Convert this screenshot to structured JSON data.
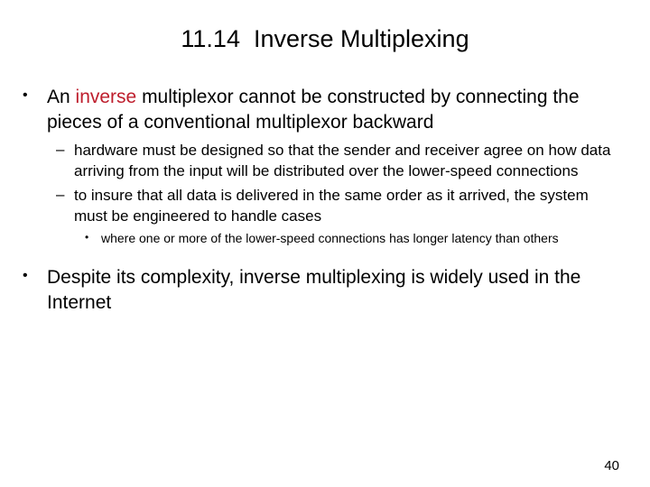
{
  "slide": {
    "title": "11.14  Inverse Multiplexing",
    "page_number": "40",
    "background_color": "#FFFFFF",
    "text_color": "#000000",
    "highlight_color": "#BE1E2D",
    "bullet_glyphs": {
      "level1": "•",
      "level2": "–",
      "level3": "•"
    },
    "bullets": [
      {
        "level": 1,
        "text_before_highlight": "An ",
        "highlight": "inverse",
        "text_after_highlight": " multiplexor cannot be constructed by connecting the pieces of a conventional multiplexor backward"
      },
      {
        "level": 2,
        "text": "hardware must be designed so that the sender and receiver agree on how data arriving from the input will be distributed over the lower-speed connections"
      },
      {
        "level": 2,
        "text": "to insure that all data is delivered in the same order as it arrived, the system must be engineered to handle cases"
      },
      {
        "level": 3,
        "text": "where one or more of the lower-speed connections has longer latency than others"
      },
      {
        "level": 1,
        "text": "Despite its complexity, inverse multiplexing is widely used in the Internet"
      }
    ]
  }
}
